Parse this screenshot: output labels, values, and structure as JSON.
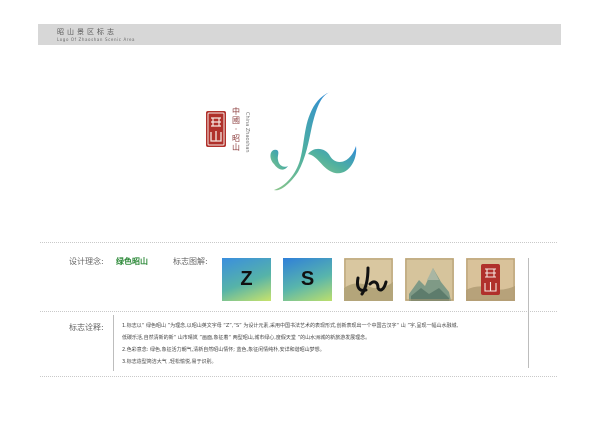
{
  "header": {
    "title": "昭山景区标志",
    "subtitle": "Logo Of Zhaoshan Scenic Area"
  },
  "logo": {
    "seal_text": "昭山",
    "name_zh": "中國·昭山",
    "name_en": "China Zhaoshan",
    "gradient_colors": [
      "#2f8ad8",
      "#4fb0a0",
      "#8bc58a"
    ],
    "seal_color": "#b0302b"
  },
  "design": {
    "label": "设计理念:",
    "value": "绿色昭山",
    "value_color": "#2e8a3a"
  },
  "illustration": {
    "label": "标志图解:",
    "tiles": [
      {
        "kind": "letter",
        "letter": "Z"
      },
      {
        "kind": "letter",
        "letter": "S"
      },
      {
        "kind": "painting",
        "icon": "shan-calligraphy-on-landscape"
      },
      {
        "kind": "painting",
        "icon": "mountain-landscape-painting"
      },
      {
        "kind": "painting",
        "icon": "zhaoshan-seal-on-painting"
      }
    ]
  },
  "notes": {
    "label": "标志诠释:",
    "lines": [
      "1.标志以“ 绿色昭山 ”为理念,以昭山英文字母 “Z”,“S” 为设计元素,采用中国书法艺术的表现形式,创新表现出一个中国古汉字“ 山 ”字,呈现一幅山水融城,",
      "低碳乐活,自然清新的新“ 山市晴岚 ”画面,象征着“ 两型昭山,城市绿心,度假天堂 ”的山水洲城的新旅游发展理念。",
      "2.色彩意念:  绿色,象征活力朝气,清新自然昭山情怀;  蓝色,象征闲情纯朴,安详和谐昭山梦想。",
      "3.标志造型简洁大气 ,轻松愉悦,易于识别。"
    ]
  }
}
